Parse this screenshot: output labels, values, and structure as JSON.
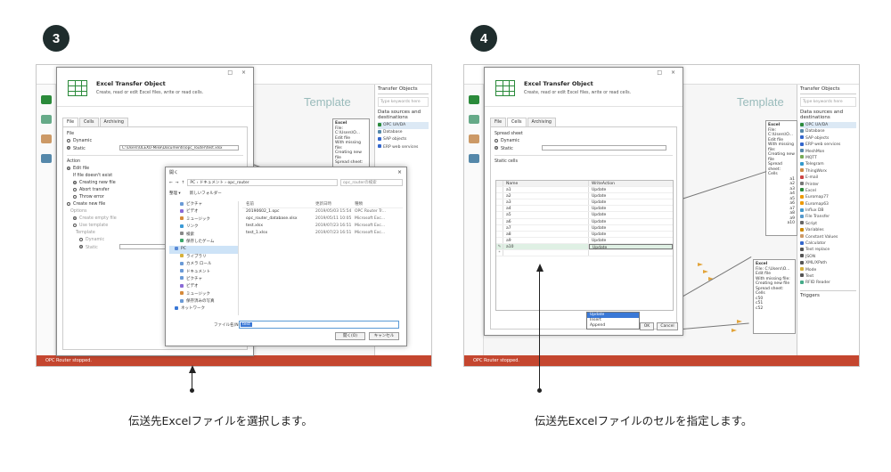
{
  "panel_left": {
    "step": "3",
    "template_label": "Template",
    "status": "OPC Router stopped.",
    "dialog": {
      "title": "Excel Transfer Object",
      "subtitle": "Create, read or edit Excel files, write or read cells.",
      "tabs": [
        "File",
        "Cells",
        "Archiving"
      ],
      "file_label": "File",
      "dynamic": "Dynamic",
      "static": "Static",
      "static_path": "C:\\Users\\OLEXO-Mike\\Documents\\opc_router\\test.xlsx",
      "action_label": "Action",
      "edit_file": "Edit file",
      "if_not_exist": "If file doesn't exist",
      "creating_new": "Creating new file",
      "abort_transfer": "Abort transfer",
      "throw_error": "Throw error",
      "create_new": "Create new file",
      "options": "Options",
      "create_empty": "Create empty file",
      "use_template": "Use template",
      "template": "Template",
      "t_dynamic": "Dynamic",
      "t_static": "Static"
    },
    "file_dialog": {
      "title": "開く",
      "path": "PC › ドキュメント › opc_router",
      "search": "opc_routerの検索",
      "organize": "整理 ▾",
      "new_folder": "新しいフォルダー",
      "tree": [
        "ピクチャ",
        "ビデオ",
        "ミュージック",
        "リンク",
        "検索",
        "保存したゲーム",
        "PC",
        "ライブラリ",
        "カメラ ロール",
        "ドキュメント",
        "ピクチャ",
        "ビデオ",
        "ミュージック",
        "保存済みの写真",
        "ネットワーク"
      ],
      "cols": {
        "name": "名前",
        "date": "更新日時",
        "type": "種類"
      },
      "files": [
        {
          "name": "20190602_1.opc",
          "date": "2019/05/03 15:54",
          "type": "OPC Router Tr..."
        },
        {
          "name": "opc_router_database.xlsx",
          "date": "2019/05/11 10:05",
          "type": "Microsoft Exc..."
        },
        {
          "name": "test.xlsx",
          "date": "2019/07/23 16:51",
          "type": "Microsoft Exc..."
        },
        {
          "name": "test_1.xlsx",
          "date": "2019/07/23 16:51",
          "type": "Microsoft Exc..."
        }
      ],
      "filename_label": "ファイル名(N):",
      "filename_value": "test",
      "open": "開く(O)",
      "cancel": "キャンセル"
    },
    "caption": "伝送先Excelファイルを選択します。"
  },
  "panel_right": {
    "step": "4",
    "template_label": "Template",
    "status": "OPC Router stopped.",
    "dialog": {
      "title": "Excel Transfer Object",
      "subtitle": "Create, read or edit Excel files, write or read cells.",
      "tabs": [
        "File",
        "Cells",
        "Archiving"
      ],
      "spreadsheet_label": "Spread sheet",
      "dynamic": "Dynamic",
      "static": "Static",
      "static_cells": "Static cells",
      "col_name": "Name",
      "col_writeaction": "WriteAction",
      "cells": [
        {
          "name": "a1",
          "wa": "Update"
        },
        {
          "name": "a2",
          "wa": "Update"
        },
        {
          "name": "a3",
          "wa": "Update"
        },
        {
          "name": "a4",
          "wa": "Update"
        },
        {
          "name": "a5",
          "wa": "Update"
        },
        {
          "name": "a6",
          "wa": "Update"
        },
        {
          "name": "a7",
          "wa": "Update"
        },
        {
          "name": "a8",
          "wa": "Update"
        },
        {
          "name": "a9",
          "wa": "Update"
        },
        {
          "name": "a10",
          "wa": "Update"
        }
      ],
      "dropdown": [
        "Update",
        "Insert",
        "Append"
      ],
      "ok": "OK",
      "cancel": "Cancel"
    },
    "caption": "伝送先Excelファイルのセルを指定します。"
  },
  "right_panel": {
    "title": "Transfer Objects",
    "search": "Type keywords here",
    "heading": "Data sources and destinations",
    "items": [
      "OPC UA/DA",
      "Database",
      "SAP objects",
      "ERP web services",
      "MeshMon",
      "MQTT",
      "Telegram",
      "ThingWorx",
      "E-mail",
      "Printer",
      "Excel",
      "Euromap77",
      "Euromap63",
      "Influx DB",
      "File Transfer",
      "Script",
      "Variables",
      "Constant Values",
      "Calculator",
      "Text replace",
      "JSON",
      "XML/XPath",
      "Mode",
      "Text",
      "RFID Reader"
    ],
    "triggers": "Triggers"
  },
  "canvas_box": {
    "title": "Excel",
    "lines": [
      "File: C:\\Users\\O...",
      "Edit file",
      "With missing file:",
      "Creating new file",
      "Spread sheet:",
      "Cells"
    ],
    "cells": [
      "a1",
      "a2",
      "a3",
      "a4",
      "a5",
      "a6",
      "a7",
      "a8",
      "a9",
      "a10"
    ],
    "cells2": [
      "c50",
      "c51",
      "c52"
    ]
  },
  "colors": {
    "accent_green": "#2a8a3a",
    "status_red": "#c4462f",
    "badge": "#1f2d2d",
    "arrow": "#e2a43a"
  }
}
